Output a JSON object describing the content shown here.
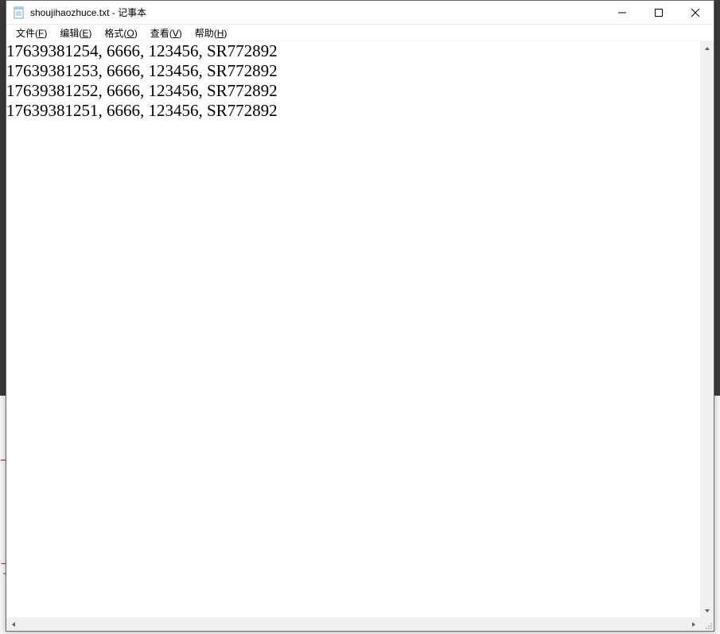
{
  "background": {
    "red_text_1": "下",
    "red_text_2": "了"
  },
  "window": {
    "filename": "shoujihaozhuce.txt",
    "app_name": "记事本",
    "title_sep": " - "
  },
  "menu": {
    "file": "文件(",
    "file_u": "F",
    "file_end": ")",
    "edit": "编辑(",
    "edit_u": "E",
    "edit_end": ")",
    "format": "格式(",
    "format_u": "O",
    "format_end": ")",
    "view": "查看(",
    "view_u": "V",
    "view_end": ")",
    "help": "帮助(",
    "help_u": "H",
    "help_end": ")"
  },
  "content": {
    "lines": [
      "17639381254, 6666, 123456, SR772892",
      "17639381253, 6666, 123456, SR772892",
      "17639381252, 6666, 123456, SR772892",
      "17639381251, 6666, 123456, SR772892"
    ]
  }
}
